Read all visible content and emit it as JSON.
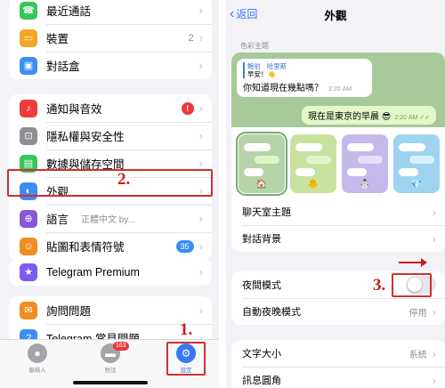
{
  "left": {
    "group1": [
      {
        "label": "最近通話",
        "icon": "phone-icon",
        "color": "#34c759",
        "glyph": "☎"
      },
      {
        "label": "裝置",
        "icon": "device-icon",
        "color": "#f5a623",
        "glyph": "▭",
        "value": "2"
      },
      {
        "label": "對話盒",
        "icon": "folder-icon",
        "color": "#3a8ef6",
        "glyph": "▣"
      }
    ],
    "group2": [
      {
        "label": "通知與音效",
        "icon": "bell-icon",
        "color": "#ef3b3b",
        "glyph": "♪",
        "badge": "!"
      },
      {
        "label": "隱私權與安全性",
        "icon": "lock-icon",
        "color": "#8e8e93",
        "glyph": "⊡"
      },
      {
        "label": "數據與儲存空間",
        "icon": "data-icon",
        "color": "#34c759",
        "glyph": "▤"
      },
      {
        "label": "外觀",
        "icon": "appearance-icon",
        "color": "#3a8ef6",
        "glyph": "◐"
      },
      {
        "label": "語言",
        "icon": "globe-icon",
        "color": "#8a56d8",
        "glyph": "⊕",
        "value": "正體中文 by..."
      },
      {
        "label": "貼圖和表情符號",
        "icon": "sticker-icon",
        "color": "#f08c21",
        "glyph": "☺",
        "badge_blue": "35"
      }
    ],
    "group3": [
      {
        "label": "Telegram Premium",
        "icon": "star-icon",
        "color": "#7d5cf0",
        "glyph": "★"
      }
    ],
    "group4": [
      {
        "label": "詢問問題",
        "icon": "chat-icon",
        "color": "#f08c21",
        "glyph": "✉"
      },
      {
        "label": "Telegram 常見問題",
        "icon": "help-icon",
        "color": "#3a8ef6",
        "glyph": "?"
      }
    ],
    "tabbar": {
      "contacts": "聯絡人",
      "chats": "對話",
      "chats_badge": "163",
      "settings": "設定"
    },
    "annotations": {
      "step1": "1.",
      "step2": "2."
    }
  },
  "right": {
    "back_label": "返回",
    "title": "外觀",
    "section_header": "色彩主題",
    "preview": {
      "quote_name": "鮑伯 · 哈里斯",
      "quote_text": "早安！👋",
      "incoming_msg": "你知道現在幾點嗎？",
      "incoming_time": "2:20 AM",
      "outgoing_msg": "現在是東京的早晨 😎",
      "outgoing_time": "2:20 AM ✓✓"
    },
    "theme_emojis": [
      "🏠",
      "🐥",
      "⛄",
      "💎"
    ],
    "rows1": [
      {
        "label": "聊天室主題"
      },
      {
        "label": "對話背景"
      }
    ],
    "night_mode_label": "夜間模式",
    "night_mode_on": false,
    "auto_night_label": "自動夜晚模式",
    "auto_night_value": "停用",
    "text_size_label": "文字大小",
    "text_size_value": "系統",
    "bubble_corner_label": "訊息圓角",
    "annotation_step3": "3."
  },
  "colors": {
    "accent": "#3478f6",
    "annotation_red": "#d32f2f",
    "chat_bg": "#a8c99a"
  }
}
